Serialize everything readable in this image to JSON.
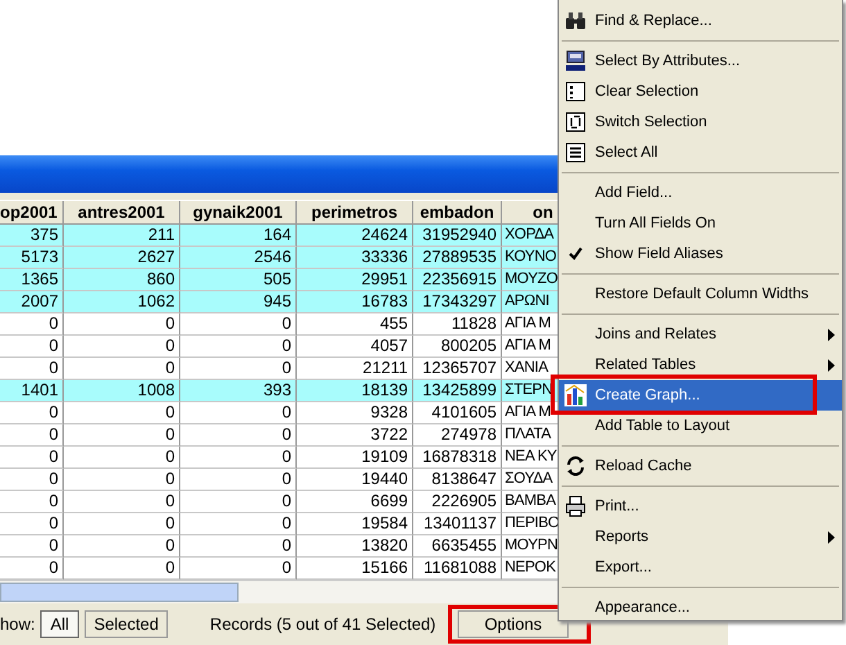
{
  "table": {
    "columns": [
      "op2001",
      "antres2001",
      "gynaik2001",
      "perimetros",
      "embadon",
      "on"
    ],
    "rows": [
      {
        "selected": true,
        "cells": [
          "375",
          "211",
          "164",
          "24624",
          "31952940",
          "ΧΟΡΔΑ"
        ]
      },
      {
        "selected": true,
        "cells": [
          "5173",
          "2627",
          "2546",
          "33336",
          "27889535",
          "ΚΟΥΝΟ"
        ]
      },
      {
        "selected": true,
        "cells": [
          "1365",
          "860",
          "505",
          "29951",
          "22356915",
          "ΜΟΥΖΟ"
        ]
      },
      {
        "selected": true,
        "cells": [
          "2007",
          "1062",
          "945",
          "16783",
          "17343297",
          "ΑΡΩΝΙ"
        ]
      },
      {
        "selected": false,
        "cells": [
          "0",
          "0",
          "0",
          "455",
          "11828",
          "ΑΓΙΑ Μ"
        ]
      },
      {
        "selected": false,
        "cells": [
          "0",
          "0",
          "0",
          "4057",
          "800205",
          "ΑΓΙΑ Μ"
        ]
      },
      {
        "selected": false,
        "cells": [
          "0",
          "0",
          "0",
          "21211",
          "12365707",
          "ΧΑΝΙΑ"
        ]
      },
      {
        "selected": true,
        "cells": [
          "1401",
          "1008",
          "393",
          "18139",
          "13425899",
          "ΣΤΕΡΝ"
        ]
      },
      {
        "selected": false,
        "cells": [
          "0",
          "0",
          "0",
          "9328",
          "4101605",
          "ΑΓΙΑ Μ"
        ]
      },
      {
        "selected": false,
        "cells": [
          "0",
          "0",
          "0",
          "3722",
          "274978",
          "ΠΛΑΤΑ"
        ]
      },
      {
        "selected": false,
        "cells": [
          "0",
          "0",
          "0",
          "19109",
          "16878318",
          "ΝΕΑ ΚΥ"
        ]
      },
      {
        "selected": false,
        "cells": [
          "0",
          "0",
          "0",
          "19440",
          "8138647",
          "ΣΟΥΔΑ"
        ]
      },
      {
        "selected": false,
        "cells": [
          "0",
          "0",
          "0",
          "6699",
          "2226905",
          "ΒΑΜΒΑ"
        ]
      },
      {
        "selected": false,
        "cells": [
          "0",
          "0",
          "0",
          "19584",
          "13401137",
          "ΠΕΡΙΒΟ"
        ]
      },
      {
        "selected": false,
        "cells": [
          "0",
          "0",
          "0",
          "13820",
          "6635455",
          "ΜΟΥΡΝ"
        ]
      },
      {
        "selected": false,
        "cells": [
          "0",
          "0",
          "0",
          "15166",
          "11681088",
          "ΝΕΡΟΚ"
        ]
      }
    ]
  },
  "footer": {
    "show_label": "how:",
    "show_buttons": [
      {
        "label": "All",
        "selected": true
      },
      {
        "label": "Selected",
        "selected": false
      }
    ],
    "records": "Records (5 out of 41 Selected)",
    "options_button": {
      "label": "Options",
      "highlighted": true
    }
  },
  "menu": {
    "groups": [
      [
        {
          "label": "Find & Replace...",
          "checked": false,
          "submenu": false,
          "selected": false,
          "highlighted": false
        }
      ],
      [
        {
          "label": "Select By Attributes...",
          "checked": false,
          "submenu": false,
          "selected": false,
          "highlighted": false
        },
        {
          "label": "Clear Selection",
          "checked": false,
          "submenu": false,
          "selected": false,
          "highlighted": false
        },
        {
          "label": "Switch Selection",
          "checked": false,
          "submenu": false,
          "selected": false,
          "highlighted": false
        },
        {
          "label": "Select All",
          "checked": false,
          "submenu": false,
          "selected": false,
          "highlighted": false
        }
      ],
      [
        {
          "label": "Add Field...",
          "checked": false,
          "submenu": false,
          "selected": false,
          "highlighted": false
        },
        {
          "label": "Turn All Fields On",
          "checked": false,
          "submenu": false,
          "selected": false,
          "highlighted": false
        },
        {
          "label": "Show Field Aliases",
          "checked": true,
          "submenu": false,
          "selected": false,
          "highlighted": false
        }
      ],
      [
        {
          "label": "Restore Default Column Widths",
          "checked": false,
          "submenu": false,
          "selected": false,
          "highlighted": false
        }
      ],
      [
        {
          "label": "Joins and Relates",
          "checked": false,
          "submenu": true,
          "selected": false,
          "highlighted": false
        },
        {
          "label": "Related Tables",
          "checked": false,
          "submenu": true,
          "selected": false,
          "highlighted": false
        },
        {
          "label": "Create Graph...",
          "checked": false,
          "submenu": false,
          "selected": true,
          "highlighted": true
        },
        {
          "label": "Add Table to Layout",
          "checked": false,
          "submenu": false,
          "selected": false,
          "highlighted": false
        }
      ],
      [
        {
          "label": "Reload Cache",
          "checked": false,
          "submenu": false,
          "selected": false,
          "highlighted": false
        }
      ],
      [
        {
          "label": "Print...",
          "checked": false,
          "submenu": false,
          "selected": false,
          "highlighted": false
        },
        {
          "label": "Reports",
          "checked": false,
          "submenu": true,
          "selected": false,
          "highlighted": false
        },
        {
          "label": "Export...",
          "checked": false,
          "submenu": false,
          "selected": false,
          "highlighted": false
        }
      ],
      [
        {
          "label": "Appearance...",
          "checked": false,
          "submenu": false,
          "selected": false,
          "highlighted": false
        }
      ]
    ]
  }
}
